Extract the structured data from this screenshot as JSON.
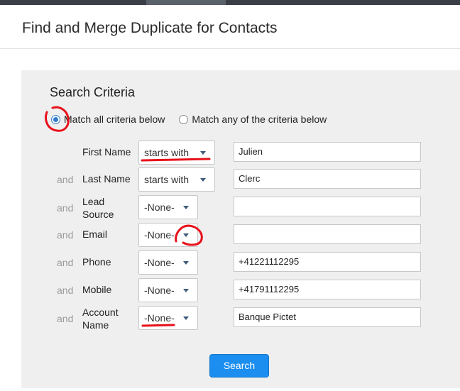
{
  "page": {
    "title": "Find and Merge Duplicate for Contacts"
  },
  "criteria": {
    "title": "Search Criteria",
    "match_all_label": "Match all criteria below",
    "match_any_label": "Match any of the criteria below",
    "selected_mode": "all",
    "rows": [
      {
        "conjunction": "",
        "field": "First Name",
        "operator": "starts with",
        "value": "Julien"
      },
      {
        "conjunction": "and",
        "field": "Last Name",
        "operator": "starts with",
        "value": "Clerc"
      },
      {
        "conjunction": "and",
        "field_line1": "Lead",
        "field_line2": "Source",
        "operator": "-None-",
        "value": ""
      },
      {
        "conjunction": "and",
        "field": "Email",
        "operator": "-None-",
        "value": ""
      },
      {
        "conjunction": "and",
        "field": "Phone",
        "operator": "-None-",
        "value": "+41221112295"
      },
      {
        "conjunction": "and",
        "field": "Mobile",
        "operator": "-None-",
        "value": "+41791112295"
      },
      {
        "conjunction": "and",
        "field_line1": "Account",
        "field_line2": "Name",
        "operator": "-None-",
        "value": "Banque Pictet"
      }
    ]
  },
  "actions": {
    "search_label": "Search"
  },
  "colors": {
    "accent": "#1b8ef0",
    "annotation": "#e8101a"
  }
}
